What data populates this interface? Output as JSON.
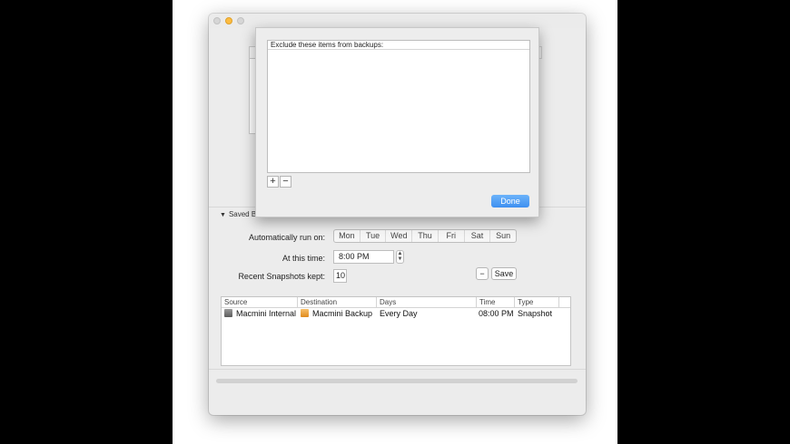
{
  "window": {
    "traffic_lights": [
      "close",
      "minimize",
      "zoom"
    ]
  },
  "sheet": {
    "list_header": "Exclude these items from backups:",
    "add_label": "+",
    "remove_label": "−",
    "done_label": "Done"
  },
  "schedule": {
    "section_label": "Saved B",
    "run_on_label": "Automatically run on:",
    "days": [
      "Mon",
      "Tue",
      "Wed",
      "Thu",
      "Fri",
      "Sat",
      "Sun"
    ],
    "time_label": "At this time:",
    "time_value": "8:00 PM",
    "snapshots_label": "Recent Snapshots kept:",
    "snapshots_value": "10",
    "remove_label": "−",
    "save_label": "Save"
  },
  "table": {
    "columns": [
      "Source",
      "Destination",
      "Days",
      "Time",
      "Type"
    ],
    "rows": [
      {
        "source": "Macmini Internal",
        "destination": "Macmini Backup",
        "days": "Every Day",
        "time": "08:00 PM",
        "type": "Snapshot"
      }
    ]
  },
  "progress": {
    "fraction": 0.0
  },
  "colors": {
    "accent": "#3e8ff0",
    "minimize": "#fdbc40"
  }
}
